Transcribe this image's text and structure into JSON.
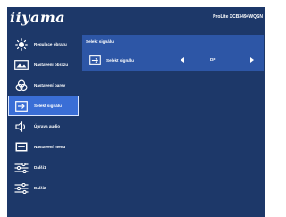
{
  "header": {
    "brand": "iiyama",
    "model": "ProLite XCB3494WQSN"
  },
  "sidebar": {
    "items": [
      {
        "label": "Regulace obrazu",
        "icon": "brightness-icon"
      },
      {
        "label": "Nastavení obrazu",
        "icon": "picture-icon"
      },
      {
        "label": "Nastavení barev",
        "icon": "color-palette-icon"
      },
      {
        "label": "Selekt signálu",
        "icon": "input-signal-icon",
        "selected": true
      },
      {
        "label": "Úprava audio",
        "icon": "speaker-icon"
      },
      {
        "label": "Nastavení menu",
        "icon": "menu-settings-icon"
      },
      {
        "label": "Další1",
        "icon": "sliders-icon"
      },
      {
        "label": "Další2",
        "icon": "sliders-icon"
      }
    ]
  },
  "panel": {
    "title": "Selekt signálu",
    "row": {
      "label": "Selekt signálu",
      "value": "DP",
      "icon": "input-signal-icon"
    }
  },
  "colors": {
    "osd_background": "#1d3869",
    "panel_background": "#2d56a6",
    "selected_background": "#3a6ed6",
    "text": "#ffffff"
  }
}
